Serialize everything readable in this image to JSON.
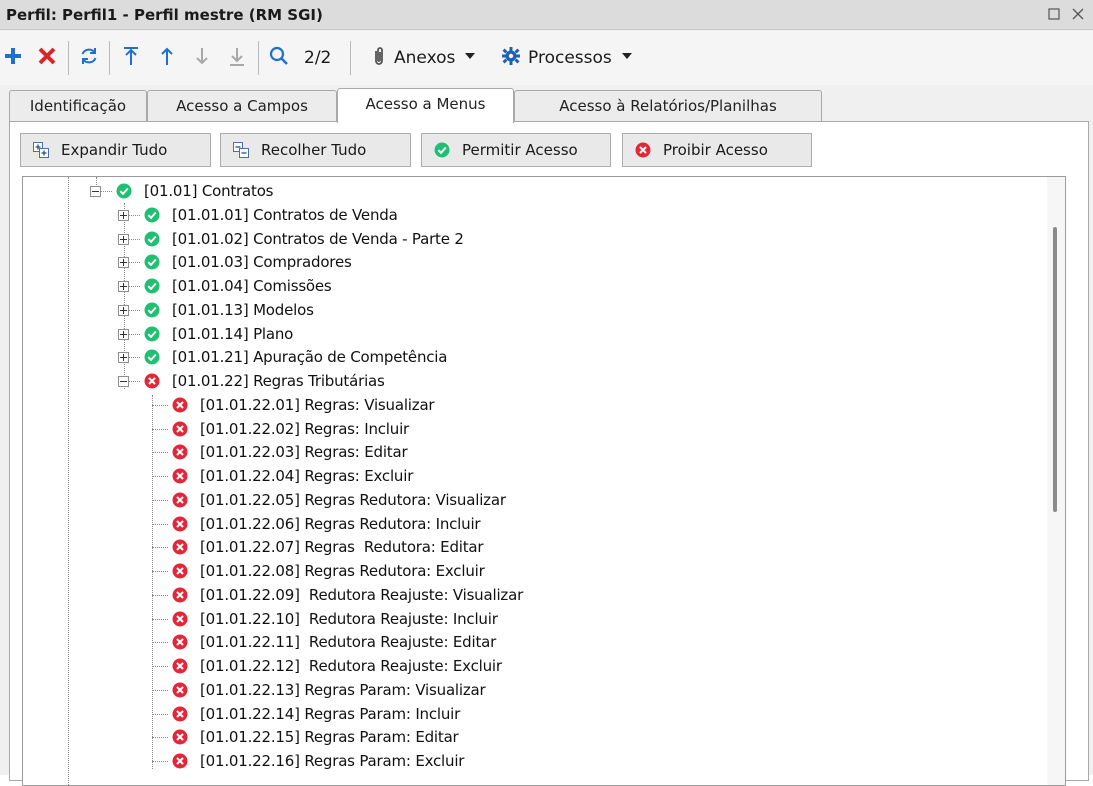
{
  "window": {
    "title": "Perfil: Perfil1 - Perfil mestre (RM SGI)"
  },
  "toolbar": {
    "record_position": "2/2",
    "anexos_label": "Anexos",
    "processos_label": "Processos"
  },
  "tabs": [
    {
      "label": "Identificação",
      "active": false
    },
    {
      "label": "Acesso a Campos",
      "active": false
    },
    {
      "label": "Acesso a Menus",
      "active": true
    },
    {
      "label": "Acesso à Relatórios/Planilhas",
      "active": false
    }
  ],
  "actions": {
    "expand_all": "Expandir Tudo",
    "collapse_all": "Recolher Tudo",
    "allow_access": "Permitir Acesso",
    "deny_access": "Proibir Acesso"
  },
  "tree": {
    "nodes": [
      {
        "label": "[01.01] Contratos",
        "status": "allowed",
        "level": 0,
        "expander": "minus"
      },
      {
        "label": "[01.01.01] Contratos de Venda",
        "status": "allowed",
        "level": 1,
        "expander": "plus"
      },
      {
        "label": "[01.01.02] Contratos de Venda - Parte 2",
        "status": "allowed",
        "level": 1,
        "expander": "plus"
      },
      {
        "label": "[01.01.03] Compradores",
        "status": "allowed",
        "level": 1,
        "expander": "plus"
      },
      {
        "label": "[01.01.04] Comissões",
        "status": "allowed",
        "level": 1,
        "expander": "plus"
      },
      {
        "label": "[01.01.13] Modelos",
        "status": "allowed",
        "level": 1,
        "expander": "plus"
      },
      {
        "label": "[01.01.14] Plano",
        "status": "allowed",
        "level": 1,
        "expander": "plus"
      },
      {
        "label": "[01.01.21] Apuração de Competência",
        "status": "allowed",
        "level": 1,
        "expander": "plus"
      },
      {
        "label": "[01.01.22] Regras Tributárias",
        "status": "denied",
        "level": 1,
        "expander": "minus"
      },
      {
        "label": "[01.01.22.01] Regras: Visualizar",
        "status": "denied",
        "level": 2,
        "expander": "none"
      },
      {
        "label": "[01.01.22.02] Regras: Incluir",
        "status": "denied",
        "level": 2,
        "expander": "none"
      },
      {
        "label": "[01.01.22.03] Regras: Editar",
        "status": "denied",
        "level": 2,
        "expander": "none"
      },
      {
        "label": "[01.01.22.04] Regras: Excluir",
        "status": "denied",
        "level": 2,
        "expander": "none"
      },
      {
        "label": "[01.01.22.05] Regras Redutora: Visualizar",
        "status": "denied",
        "level": 2,
        "expander": "none"
      },
      {
        "label": "[01.01.22.06] Regras Redutora: Incluir",
        "status": "denied",
        "level": 2,
        "expander": "none"
      },
      {
        "label": "[01.01.22.07] Regras  Redutora: Editar",
        "status": "denied",
        "level": 2,
        "expander": "none"
      },
      {
        "label": "[01.01.22.08] Regras Redutora: Excluir",
        "status": "denied",
        "level": 2,
        "expander": "none"
      },
      {
        "label": "[01.01.22.09]  Redutora Reajuste: Visualizar",
        "status": "denied",
        "level": 2,
        "expander": "none"
      },
      {
        "label": "[01.01.22.10]  Redutora Reajuste: Incluir",
        "status": "denied",
        "level": 2,
        "expander": "none"
      },
      {
        "label": "[01.01.22.11]  Redutora Reajuste: Editar",
        "status": "denied",
        "level": 2,
        "expander": "none"
      },
      {
        "label": "[01.01.22.12]  Redutora Reajuste: Excluir",
        "status": "denied",
        "level": 2,
        "expander": "none"
      },
      {
        "label": "[01.01.22.13] Regras Param: Visualizar",
        "status": "denied",
        "level": 2,
        "expander": "none"
      },
      {
        "label": "[01.01.22.14] Regras Param: Incluir",
        "status": "denied",
        "level": 2,
        "expander": "none"
      },
      {
        "label": "[01.01.22.15] Regras Param: Editar",
        "status": "denied",
        "level": 2,
        "expander": "none"
      },
      {
        "label": "[01.01.22.16] Regras Param: Excluir",
        "status": "denied",
        "level": 2,
        "expander": "none"
      }
    ]
  },
  "colors": {
    "allowed": "#1fbf74",
    "denied": "#e0283a",
    "add_icon": "#1f6fd1",
    "delete_icon": "#d62828"
  },
  "icons": {
    "allowed": "check-circle-icon",
    "denied": "x-circle-icon"
  }
}
